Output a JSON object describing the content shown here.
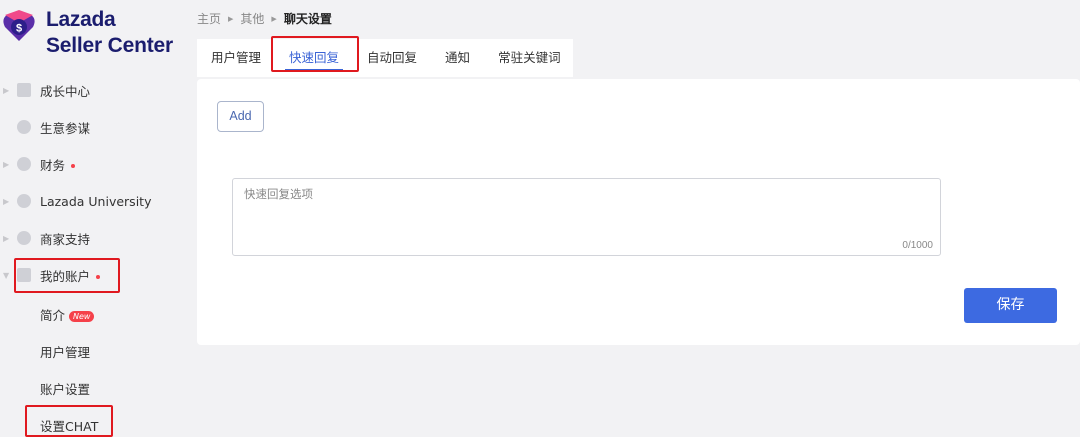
{
  "brand": {
    "name": "Lazada",
    "sub": "Seller Center",
    "colors": {
      "primary": "#1b1d6e",
      "accent": "#3d6ae1",
      "alert": "#e0191f"
    }
  },
  "sidebar": {
    "items": [
      {
        "label": "成长中心",
        "icon": "growth-icon",
        "badge_dot": false
      },
      {
        "label": "生意参谋",
        "icon": "analytics-icon",
        "badge_dot": false
      },
      {
        "label": "财务",
        "icon": "finance-icon",
        "badge_dot": true
      },
      {
        "label": "Lazada University",
        "icon": "university-icon",
        "badge_dot": false
      },
      {
        "label": "商家支持",
        "icon": "support-icon",
        "badge_dot": false
      },
      {
        "label": "我的账户",
        "icon": "account-icon",
        "badge_dot": true,
        "expanded": true
      }
    ],
    "sub_items": [
      {
        "label": "简介",
        "badge": "New"
      },
      {
        "label": "用户管理"
      },
      {
        "label": "账户设置"
      },
      {
        "label": "设置CHAT"
      }
    ]
  },
  "breadcrumb": {
    "items": [
      "主页",
      "其他",
      "聊天设置"
    ]
  },
  "tabs": [
    {
      "label": "用户管理"
    },
    {
      "label": "快速回复",
      "active": true
    },
    {
      "label": "自动回复"
    },
    {
      "label": "通知"
    },
    {
      "label": "常驻关键词"
    }
  ],
  "quick_reply": {
    "add_label": "Add",
    "placeholder": "快速回复选项",
    "counter": "0/1000",
    "save_label": "保存"
  }
}
